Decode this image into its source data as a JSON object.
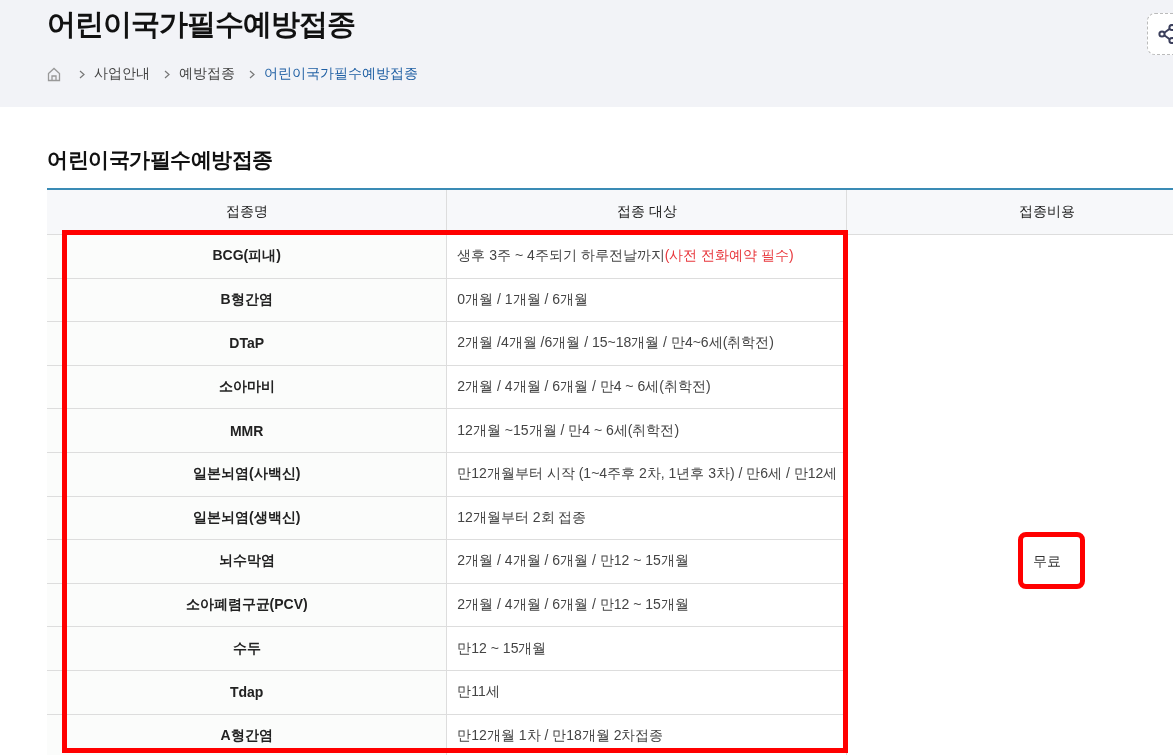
{
  "page_title": "어린이국가필수예방접종",
  "breadcrumb": [
    {
      "label": "사업안내",
      "current": false
    },
    {
      "label": "예방접종",
      "current": false
    },
    {
      "label": "어린이국가필수예방접종",
      "current": true
    }
  ],
  "section_title": "어린이국가필수예방접종",
  "table": {
    "columns": [
      "접종명",
      "접종 대상",
      "접종비용"
    ],
    "cost": "무료",
    "rows": [
      {
        "name": "BCG(피내)",
        "target": "생후 3주 ~ 4주되기 하루전날까지",
        "note": "(사전 전화예약 필수)"
      },
      {
        "name": "B형간염",
        "target": "0개월 / 1개월 / 6개월"
      },
      {
        "name": "DTaP",
        "target": "2개월 /4개월 /6개월 / 15~18개월 / 만4~6세(취학전)"
      },
      {
        "name": "소아마비",
        "target": "2개월 / 4개월 / 6개월 / 만4 ~ 6세(취학전)"
      },
      {
        "name": "MMR",
        "target": "12개월 ~15개월 / 만4 ~ 6세(취학전)"
      },
      {
        "name": "일본뇌염(사백신)",
        "target": "만12개월부터 시작 (1~4주후 2차, 1년후 3차) / 만6세 / 만12세"
      },
      {
        "name": "일본뇌염(생백신)",
        "target": "12개월부터 2회 접종"
      },
      {
        "name": "뇌수막염",
        "target": "2개월 / 4개월 / 6개월 / 만12 ~ 15개월"
      },
      {
        "name": "소아폐렴구균(PCV)",
        "target": "2개월 / 4개월 / 6개월 / 만12 ~ 15개월"
      },
      {
        "name": "수두",
        "target": "만12 ~ 15개월"
      },
      {
        "name": "Tdap",
        "target": "만11세"
      },
      {
        "name": "A형간염",
        "target": "만12개월 1차 / 만18개월 2차접종"
      }
    ]
  },
  "highlights": {
    "rows": {
      "color": "#ff0000"
    },
    "cost": {
      "color": "#ff0000"
    }
  }
}
